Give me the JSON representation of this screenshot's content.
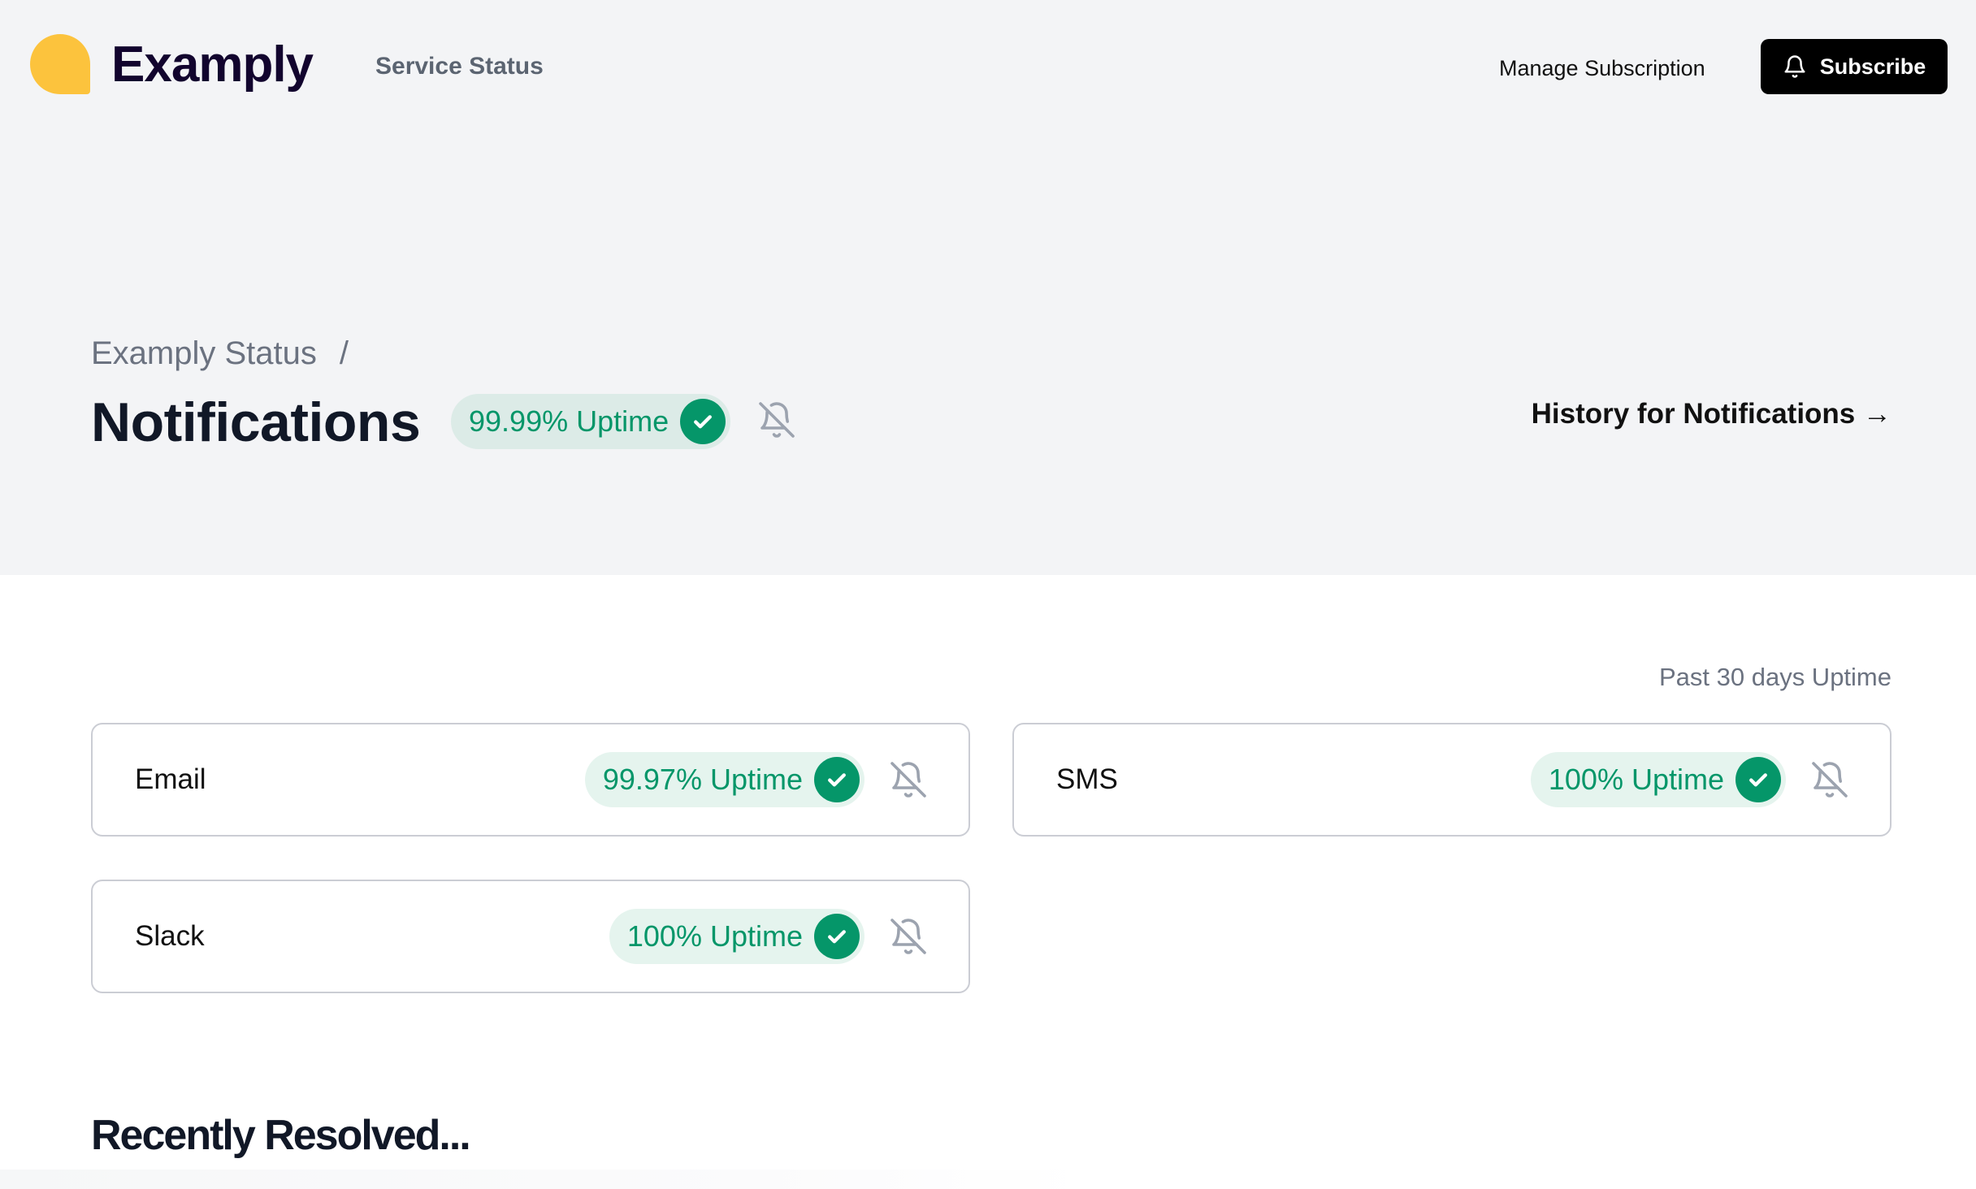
{
  "nav": {
    "brand": "Examply",
    "service_status": "Service Status",
    "manage_subscription": "Manage Subscription",
    "subscribe": "Subscribe",
    "logo_color": "#fcc33d"
  },
  "breadcrumb": {
    "parent": "Examply Status",
    "separator": "/"
  },
  "page": {
    "title": "Notifications",
    "uptime": "99.99% Uptime",
    "history_link": "History for Notifications →",
    "uptime_window_label": "Past 30 days Uptime"
  },
  "components": [
    {
      "name": "Email",
      "uptime": "99.97% Uptime",
      "status": "operational"
    },
    {
      "name": "SMS",
      "uptime": "100% Uptime",
      "status": "operational"
    },
    {
      "name": "Slack",
      "uptime": "100% Uptime",
      "status": "operational"
    }
  ],
  "sections": {
    "recently_resolved": "Recently Resolved..."
  },
  "colors": {
    "success": "#059669",
    "success_bg": "#dcebe7",
    "muted_icon": "#9ca3af"
  },
  "icons": {
    "logo": "logo-mark",
    "subscribe": "bell-icon",
    "uptime_status": "check-circle-icon",
    "notifications": "bell-off-icon"
  }
}
